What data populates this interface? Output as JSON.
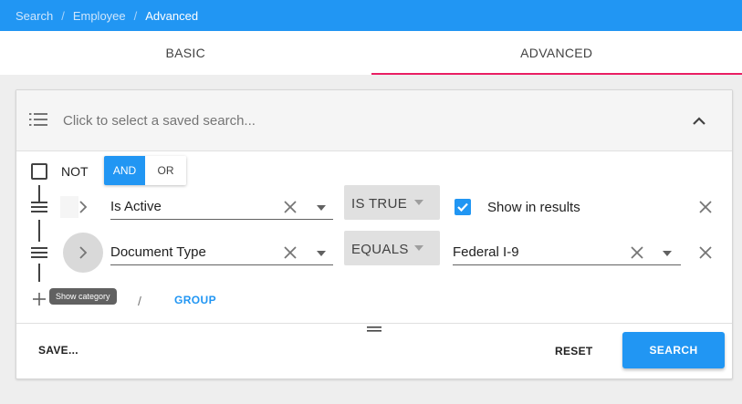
{
  "breadcrumb": {
    "items": [
      "Search",
      "Employee",
      "Advanced"
    ],
    "separator": "/"
  },
  "tabs": [
    {
      "label": "BASIC",
      "active": false
    },
    {
      "label": "ADVANCED",
      "active": true
    }
  ],
  "saved_search": {
    "placeholder": "Click to select a saved search...",
    "icon": "list-icon",
    "toggle_icon": "chevron-up-icon"
  },
  "query": {
    "not_checkbox": {
      "label": "NOT",
      "checked": false
    },
    "logic": {
      "and_label": "AND",
      "or_label": "OR",
      "selected": "AND"
    },
    "rows": [
      {
        "field": "Is Active",
        "operator": "IS TRUE",
        "show_in_results": {
          "label": "Show in results",
          "checked": true
        }
      },
      {
        "field": "Document Type",
        "operator": "EQUALS",
        "value": "Federal I-9"
      }
    ],
    "tooltip": "Show category",
    "add_separator": "/",
    "group_label": "GROUP"
  },
  "actions": {
    "save_label": "SAVE...",
    "reset_label": "RESET",
    "search_label": "SEARCH"
  },
  "colors": {
    "primary": "#2196f3",
    "tab_indicator": "#e91e63",
    "operator_bg": "#e0e0e0"
  }
}
